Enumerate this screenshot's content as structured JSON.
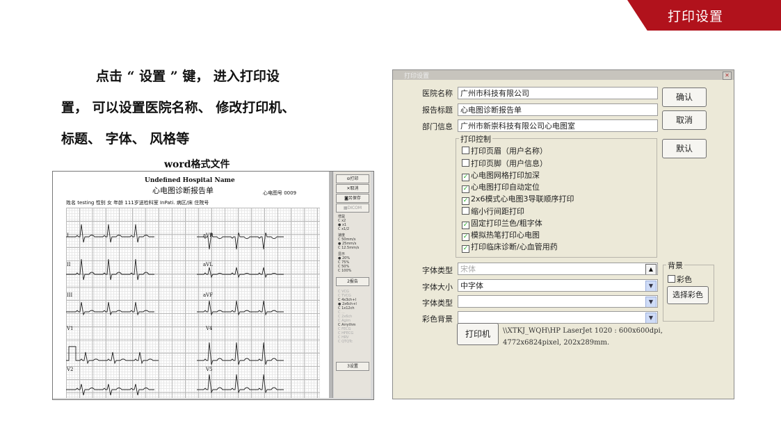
{
  "header": {
    "banner": "打印设置"
  },
  "intro": {
    "line1": "点击 “ 设置 ” 键， 进入打印设",
    "line2": "置， 可以设置医院名称、 修改打印机、",
    "line3": "标题、 字体、 风格等"
  },
  "caption": "word格式文件",
  "ecg": {
    "title": "Undefined Hospital Name",
    "subtitle": "心电图诊断报告单",
    "report_no": "心电图号 0009",
    "patient": "姓名 testing    性别 女 年龄 111岁送检科室 InPati.     病区/床          住院号",
    "leads": [
      "I",
      "II",
      "III",
      "V1",
      "V2"
    ],
    "lead_labels": [
      "aVR",
      "aVL",
      "aVF",
      "V4",
      "V5"
    ],
    "side_buttons": [
      "⊖打印",
      "✕取消",
      "◙另保存",
      "▦DICOM"
    ],
    "options": {
      "gain_title": "增益",
      "gain": [
        "C x2",
        "● x1",
        "C x1/2"
      ],
      "speed_title": "速度",
      "speed": [
        "C 50mm/s",
        "● 25mm/s",
        "C 12.5mm/s"
      ],
      "display_title": "显示",
      "display": [
        "● 20%",
        "C 75%",
        "C 50%",
        "C 100%"
      ],
      "report_btn": "2报告",
      "layout": [
        "C VCG",
        "C TVCG",
        "C 4x3ch+I",
        "● 2x6ch+I",
        "C 1x12ch",
        "C ...",
        "C 2x6ch",
        "C Agim",
        "C Arrythm",
        "C FECG",
        "C HFECG",
        "C HRV",
        "C QTQTc"
      ],
      "settings_btn": "3设置"
    }
  },
  "dialog": {
    "title": "打印设置",
    "fields": {
      "hospital_label": "医院名称",
      "hospital_value": "广州市科技有限公司",
      "report_label": "报告标题",
      "report_value": "心电图诊断报告单",
      "dept_label": "部门信息",
      "dept_value": "广州市新崇科技有限公司心电图室"
    },
    "buttons": {
      "ok": "确认",
      "cancel": "取消",
      "default": "默认",
      "color": "选择彩色",
      "printer": "打印机"
    },
    "print_control": {
      "title": "打印控制",
      "items": [
        {
          "label": "打印页眉（用户名称）",
          "checked": false
        },
        {
          "label": "打印页脚（用户信息）",
          "checked": false
        },
        {
          "label": "心电图网格打印加深",
          "checked": true
        },
        {
          "label": "心电图打印自动定位",
          "checked": true
        },
        {
          "label": "2x6模式心电图3导联顺序打印",
          "checked": true
        },
        {
          "label": "缩小行间距打印",
          "checked": false
        },
        {
          "label": "固定打印兰色/粗字体",
          "checked": true
        },
        {
          "label": "模拟热笔打印心电图",
          "checked": true
        },
        {
          "label": "打印临床诊断/心血管用药",
          "checked": true
        }
      ]
    },
    "font": {
      "type_label": "字体类型",
      "type_value": "宋体",
      "size_label": "字体大小",
      "size_value": "中字体",
      "type2_label": "字体类型",
      "type2_value": "",
      "bg_label": "彩色背景",
      "bg_value": ""
    },
    "background": {
      "title": "背景",
      "color_label": "彩色",
      "color_checked": false
    },
    "printer_info": {
      "line1": "\\\\XTKJ_WQH\\HP LaserJet 1020 : 600x600dpi,",
      "line2": "4772x6824pixel, 202x289mm."
    },
    "icons": {
      "close": "close-icon",
      "dropdown": "chevron-down-icon",
      "scroll": "scroll-up-icon"
    },
    "colors": {
      "banner": "#b1121c",
      "dialog_bg": "#ece9d8"
    }
  }
}
